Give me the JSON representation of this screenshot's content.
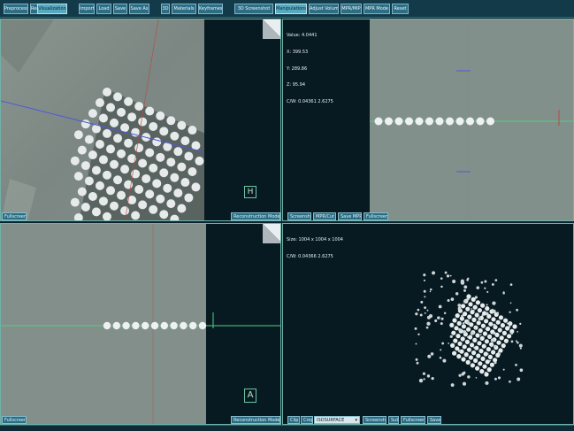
{
  "toolbar": {
    "buttons": [
      {
        "label": "Preprocess"
      },
      {
        "label": "Reconstruction"
      },
      {
        "label": "Visualization"
      },
      {
        "label": "Import"
      },
      {
        "label": "Load"
      },
      {
        "label": "Save"
      },
      {
        "label": "Save As"
      },
      {
        "label": "3D"
      },
      {
        "label": "Materials"
      },
      {
        "label": "Keyframes"
      },
      {
        "label": "3D Screenshot"
      },
      {
        "label": "Manipulations"
      },
      {
        "label": "Adjust Volume"
      },
      {
        "label": "MPR/MIP"
      },
      {
        "label": "MPR Mode"
      },
      {
        "label": "Reset"
      }
    ],
    "active_label": "Visualization"
  },
  "top_left_view": {
    "fullscreen_label": "Fullscreen",
    "mode_label": "Reconstruction Mode",
    "orientation_marker": "H"
  },
  "top_right_view": {
    "info": {
      "value": "Value: 4.0441",
      "x": "X: 399.53",
      "y": "Y: 289.86",
      "z": "Z: 95.94",
      "cw": "C/W: 0.04361 2.6275"
    },
    "buttons": [
      "Screenshot",
      "MPR/Cut",
      "Save MPR",
      "Fullscreen"
    ]
  },
  "bottom_left_view": {
    "fullscreen_label": "Fullscreen",
    "mode_label": "Reconstruction Mode",
    "orientation_marker": "A"
  },
  "bottom_right_view": {
    "info": {
      "size": "Size: 1004 x 1004 x 1004",
      "cw": "C/W: 0.04366 2.6275"
    },
    "buttons": {
      "clip": "Clip",
      "crop": "Crop",
      "render_mode": "ISOSURFACE",
      "screenshot": "Screenshot",
      "sub": "Sub",
      "fullscreen": "Fullscreen",
      "save": "Save"
    }
  },
  "colors": {
    "toolbar_bg": "#123a48",
    "button_bg": "#2d6e85",
    "active_button": "#57a9c0",
    "view_bg": "#071a22",
    "crosshair_green": "#4fd17c",
    "crosshair_red": "#d8584c",
    "crosshair_blue": "#5e6ee0"
  }
}
